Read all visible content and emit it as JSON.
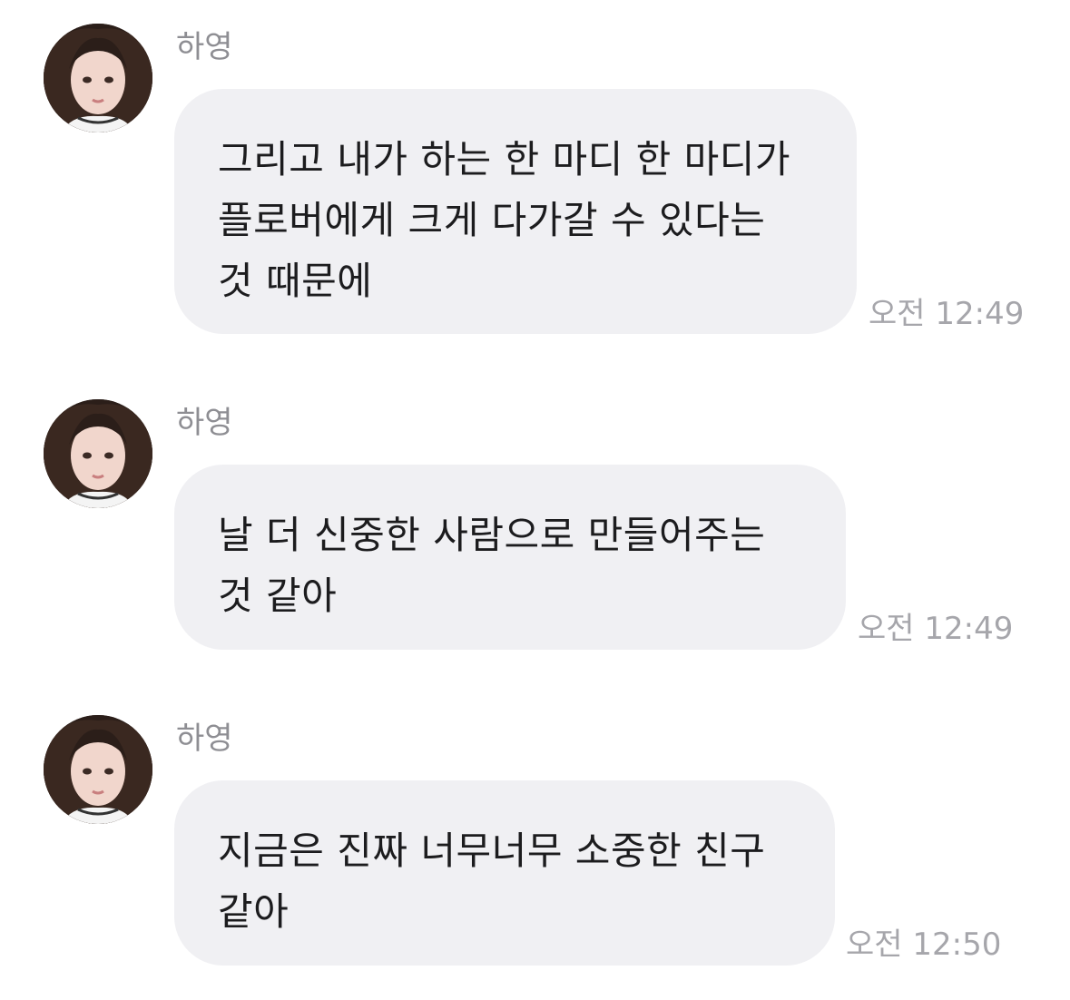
{
  "messages": [
    {
      "sender": "하영",
      "text": "그리고 내가 하는 한 마디 한 마디가\n플로버에게 크게 다가갈 수 있다는\n것 때문에",
      "time": "오전 12:49"
    },
    {
      "sender": "하영",
      "text": "날 더 신중한 사람으로 만들어주는\n것 같아",
      "time": "오전 12:49"
    },
    {
      "sender": "하영",
      "text": "지금은 진짜 너무너무 소중한 친구\n같아",
      "time": "오전 12:50"
    }
  ],
  "colors": {
    "bubble": "#f0f0f3",
    "text": "#1c1c1e",
    "sender": "#8e8e93",
    "time": "#a6a6ab"
  }
}
